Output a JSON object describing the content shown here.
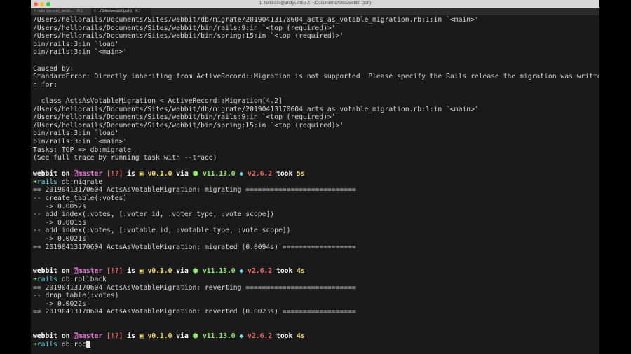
{
  "window": {
    "title": "1. hellorails@andys-mbp-2: ~/Documents/Sites/webbit (zsh)"
  },
  "tabs": [
    {
      "label": "rails (tarvent_webb...",
      "shortcut": "⌘1"
    },
    {
      "label": "../Sites/webbit (zsh)",
      "shortcut": "⌘2"
    }
  ],
  "output_top": [
    "/Users/hellorails/Documents/Sites/webbit/db/migrate/20190413170604_acts_as_votable_migration.rb:1:in `<main>'",
    "/Users/hellorails/Documents/Sites/webbit/bin/rails:9:in `<top (required)>'",
    "/Users/hellorails/Documents/Sites/webbit/bin/spring:15:in `<top (required)>'",
    "bin/rails:3:in `load'",
    "bin/rails:3:in `<main>'",
    "",
    "Caused by:",
    "StandardError: Directly inheriting from ActiveRecord::Migration is not supported. Please specify the Rails release the migration was writte",
    "n for:",
    "",
    "  class ActsAsVotableMigration < ActiveRecord::Migration[4.2]",
    "/Users/hellorails/Documents/Sites/webbit/db/migrate/20190413170604_acts_as_votable_migration.rb:1:in `<main>'",
    "/Users/hellorails/Documents/Sites/webbit/bin/rails:9:in `<top (required)>'",
    "/Users/hellorails/Documents/Sites/webbit/bin/spring:15:in `<top (required)>'",
    "bin/rails:3:in `load'",
    "bin/rails:3:in `<main>'",
    "Tasks: TOP => db:migrate",
    "(See full trace by running task with --trace)",
    ""
  ],
  "prompt": {
    "dir": "webbit",
    "on": "on",
    "branch": "master",
    "status": "[!?]",
    "is": "is",
    "pkg_version": "v0.1.0",
    "via": "via",
    "node_version": "v11.13.0",
    "ruby_version": "v2.6.2",
    "took": "took",
    "arrow": "➜",
    "cmd_prefix": "rails"
  },
  "blocks": [
    {
      "duration": "5s",
      "command": "db:migrate",
      "output": [
        "== 20190413170604 ActsAsVotableMigration: migrating ===========================",
        "-- create_table(:votes)",
        "   -> 0.0052s",
        "-- add_index(:votes, [:voter_id, :voter_type, :vote_scope])",
        "   -> 0.0015s",
        "-- add_index(:votes, [:votable_id, :votable_type, :vote_scope])",
        "   -> 0.0021s",
        "== 20190413170604 ActsAsVotableMigration: migrated (0.0094s) ==================",
        "",
        ""
      ]
    },
    {
      "duration": "4s",
      "command": "db:rollback",
      "output": [
        "== 20190413170604 ActsAsVotableMigration: reverting ===========================",
        "-- drop_table(:votes)",
        "   -> 0.0022s",
        "== 20190413170604 ActsAsVotableMigration: reverted (0.0023s) ==================",
        "",
        ""
      ]
    },
    {
      "duration": "4s",
      "command": "db:roc",
      "output": []
    }
  ]
}
